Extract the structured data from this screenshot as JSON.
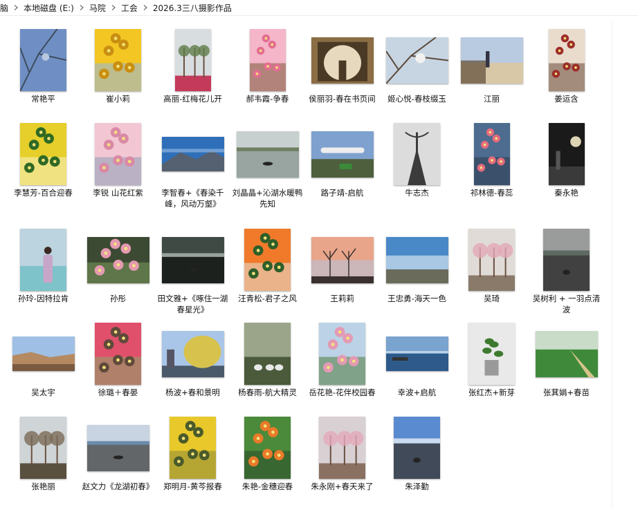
{
  "breadcrumb": [
    "脑",
    "本地磁盘 (E:)",
    "马院",
    "工会",
    "2026.3三八摄影作品"
  ],
  "files": [
    {
      "label": "常艳平",
      "icon": "photo-thumbnail-icon",
      "palette": [
        "#6f8fc4",
        "#b9c7de",
        "#3e4c5e"
      ],
      "shape": "sky-branches",
      "aspect": "portrait"
    },
    {
      "label": "崔小莉",
      "icon": "photo-thumbnail-icon",
      "palette": [
        "#f3c623",
        "#c98f12",
        "#8fb7e6"
      ],
      "shape": "flowers",
      "aspect": "portrait"
    },
    {
      "label": "高丽-红梅花儿开",
      "icon": "photo-thumbnail-icon",
      "palette": [
        "#d8dde0",
        "#5f7d48",
        "#c43a5a"
      ],
      "shape": "trees",
      "aspect": "tall"
    },
    {
      "label": "郝韦霞-争春",
      "icon": "photo-thumbnail-icon",
      "palette": [
        "#f4b6c8",
        "#e36d92",
        "#7b5a3a"
      ],
      "shape": "flowers",
      "aspect": "tall"
    },
    {
      "label": "侯丽羽-春在书页间",
      "icon": "photo-thumbnail-icon",
      "palette": [
        "#8b6d45",
        "#e7d9bd",
        "#4a3a25"
      ],
      "shape": "arch",
      "aspect": "landscape"
    },
    {
      "label": "姬心悦-春枝缀玉",
      "icon": "photo-thumbnail-icon",
      "palette": [
        "#c7d5e3",
        "#f2f2f0",
        "#5d4a3a"
      ],
      "shape": "sky-branches",
      "aspect": "landscape-sq"
    },
    {
      "label": "江丽",
      "icon": "photo-thumbnail-icon",
      "palette": [
        "#b9cbe0",
        "#d9c8a7",
        "#5e4a36"
      ],
      "shape": "river",
      "aspect": "landscape"
    },
    {
      "label": "姜运含",
      "icon": "photo-thumbnail-icon",
      "palette": [
        "#e9dccd",
        "#9c2d2a",
        "#6b4b3a"
      ],
      "shape": "flowers",
      "aspect": "tall"
    },
    {
      "label": "李慧芳-百合迎春",
      "icon": "photo-thumbnail-icon",
      "palette": [
        "#e6cf2a",
        "#2f6a24",
        "#f8f2c6"
      ],
      "shape": "flowers",
      "aspect": "portrait"
    },
    {
      "label": "李锐 山花红紫",
      "icon": "photo-thumbnail-icon",
      "palette": [
        "#f2c7d3",
        "#d98aa6",
        "#8d9fb9"
      ],
      "shape": "flowers",
      "aspect": "portrait"
    },
    {
      "label": "李智春+《春染千峰，风动万壑》",
      "icon": "photo-thumbnail-icon",
      "palette": [
        "#2f6fb9",
        "#9cc2e6",
        "#556070"
      ],
      "shape": "mountains",
      "aspect": "wide"
    },
    {
      "label": "刘晶晶+沁湖水暖鸭先知",
      "icon": "photo-thumbnail-icon",
      "palette": [
        "#c7cfcf",
        "#6f7f62",
        "#8c9a95"
      ],
      "shape": "lake",
      "aspect": "landscape"
    },
    {
      "label": "路子靖-启航",
      "icon": "photo-thumbnail-icon",
      "palette": [
        "#7ea1cf",
        "#c9c2b2",
        "#4e5f3d"
      ],
      "shape": "plane",
      "aspect": "landscape"
    },
    {
      "label": "牛志杰",
      "icon": "photo-thumbnail-icon",
      "palette": [
        "#dcdcdc",
        "#3b3b3b",
        "#bdbdbd"
      ],
      "shape": "hanger",
      "aspect": "portrait"
    },
    {
      "label": "祁林德-春蕊",
      "icon": "photo-thumbnail-icon",
      "palette": [
        "#4d6c8f",
        "#e36b7f",
        "#2e3d4e"
      ],
      "shape": "flowers",
      "aspect": "tall"
    },
    {
      "label": "秦永艳",
      "icon": "photo-thumbnail-icon",
      "palette": [
        "#1a1a1a",
        "#3a3a3a",
        "#f2e9c4"
      ],
      "shape": "night",
      "aspect": "tall"
    },
    {
      "label": "孙玲-因特拉肯",
      "icon": "photo-thumbnail-icon",
      "palette": [
        "#bcd3e0",
        "#7ec3c9",
        "#c8a6c9"
      ],
      "shape": "person",
      "aspect": "portrait"
    },
    {
      "label": "孙彤",
      "icon": "photo-thumbnail-icon",
      "palette": [
        "#3c4a33",
        "#e59ab1",
        "#7a9a5b"
      ],
      "shape": "flowers",
      "aspect": "landscape-sq"
    },
    {
      "label": "田文雅+《啄住一湖春星光》",
      "icon": "photo-thumbnail-icon",
      "palette": [
        "#3f4a44",
        "#9aa39b",
        "#141614"
      ],
      "shape": "lake",
      "aspect": "landscape"
    },
    {
      "label": "汪青松-君子之风",
      "icon": "photo-thumbnail-icon",
      "palette": [
        "#f07a2a",
        "#2f5e2a",
        "#e8e2d8"
      ],
      "shape": "flowers",
      "aspect": "portrait"
    },
    {
      "label": "王莉莉",
      "icon": "photo-thumbnail-icon",
      "palette": [
        "#e9a58a",
        "#b8c2d8",
        "#3a3030"
      ],
      "shape": "sunset-trees",
      "aspect": "landscape"
    },
    {
      "label": "王忠勇-海天一色",
      "icon": "photo-thumbnail-icon",
      "palette": [
        "#4a89c8",
        "#a9c8e4",
        "#6b6b5b"
      ],
      "shape": "sea",
      "aspect": "landscape"
    },
    {
      "label": "吴琦",
      "icon": "photo-thumbnail-icon",
      "palette": [
        "#e0dbd6",
        "#e2a8b6",
        "#8a7a6a"
      ],
      "shape": "trees",
      "aspect": "portrait"
    },
    {
      "label": "吴树利 + 一羽点清波",
      "icon": "photo-thumbnail-icon",
      "palette": [
        "#9a9c9b",
        "#5e6a61",
        "#2b2b2b"
      ],
      "shape": "lake",
      "aspect": "portrait"
    },
    {
      "label": "吴太宇",
      "icon": "photo-thumbnail-icon",
      "palette": [
        "#9fc0e4",
        "#b58a62",
        "#7a5a40"
      ],
      "shape": "rocks",
      "aspect": "wide"
    },
    {
      "label": "徐璐＋春晏",
      "icon": "photo-thumbnail-icon",
      "palette": [
        "#e0506b",
        "#5f4a3a",
        "#8aa86a"
      ],
      "shape": "flowers",
      "aspect": "portrait"
    },
    {
      "label": "杨波+春和景明",
      "icon": "photo-thumbnail-icon",
      "palette": [
        "#a9c6e8",
        "#d8c24e",
        "#4a5a6a"
      ],
      "shape": "willow",
      "aspect": "landscape"
    },
    {
      "label": "杨春雨-航大精灵",
      "icon": "photo-thumbnail-icon",
      "palette": [
        "#9aa58a",
        "#e8e8e8",
        "#4a5a3a"
      ],
      "shape": "geese",
      "aspect": "portrait"
    },
    {
      "label": "岳花艳-花伴校园春",
      "icon": "photo-thumbnail-icon",
      "palette": [
        "#bcd2e6",
        "#e39ab5",
        "#4f7a3a"
      ],
      "shape": "flowers",
      "aspect": "portrait"
    },
    {
      "label": "幸波+启航",
      "icon": "photo-thumbnail-icon",
      "palette": [
        "#7aa3cf",
        "#2d5a8a",
        "#d8e4ee"
      ],
      "shape": "bridge",
      "aspect": "wide"
    },
    {
      "label": "张红杰+新芽",
      "icon": "photo-thumbnail-icon",
      "palette": [
        "#e9e9e9",
        "#3d7a2e",
        "#9a9a9a"
      ],
      "shape": "plant",
      "aspect": "portrait"
    },
    {
      "label": "张萁娟+春苗",
      "icon": "photo-thumbnail-icon",
      "palette": [
        "#c9dcc8",
        "#3f8a3a",
        "#d6c48a"
      ],
      "shape": "field",
      "aspect": "landscape"
    },
    {
      "label": "张艳丽",
      "icon": "photo-thumbnail-icon",
      "palette": [
        "#cfd4d6",
        "#7a6a58",
        "#5a5040"
      ],
      "shape": "trees",
      "aspect": "portrait"
    },
    {
      "label": "赵文力《龙湖初春》",
      "icon": "photo-thumbnail-icon",
      "palette": [
        "#c8d4e2",
        "#6a8aa8",
        "#4a4a4a"
      ],
      "shape": "lake",
      "aspect": "landscape"
    },
    {
      "label": "郑明月-黄芩报春",
      "icon": "photo-thumbnail-icon",
      "palette": [
        "#e8c82a",
        "#4a5a2a",
        "#8a8a3a"
      ],
      "shape": "flowers",
      "aspect": "portrait"
    },
    {
      "label": "朱艳-金穗迎春",
      "icon": "photo-thumbnail-icon",
      "palette": [
        "#4a8a3a",
        "#e87a2a",
        "#2a4a2a"
      ],
      "shape": "flowers",
      "aspect": "portrait"
    },
    {
      "label": "朱永刚+春天来了",
      "icon": "photo-thumbnail-icon",
      "palette": [
        "#d8d0d2",
        "#e4a9bb",
        "#8a7060"
      ],
      "shape": "trees",
      "aspect": "portrait"
    },
    {
      "label": "朱泽勤",
      "icon": "photo-thumbnail-icon",
      "palette": [
        "#5a8ad0",
        "#c9dcef",
        "#3a3a3a"
      ],
      "shape": "lake",
      "aspect": "portrait"
    }
  ]
}
